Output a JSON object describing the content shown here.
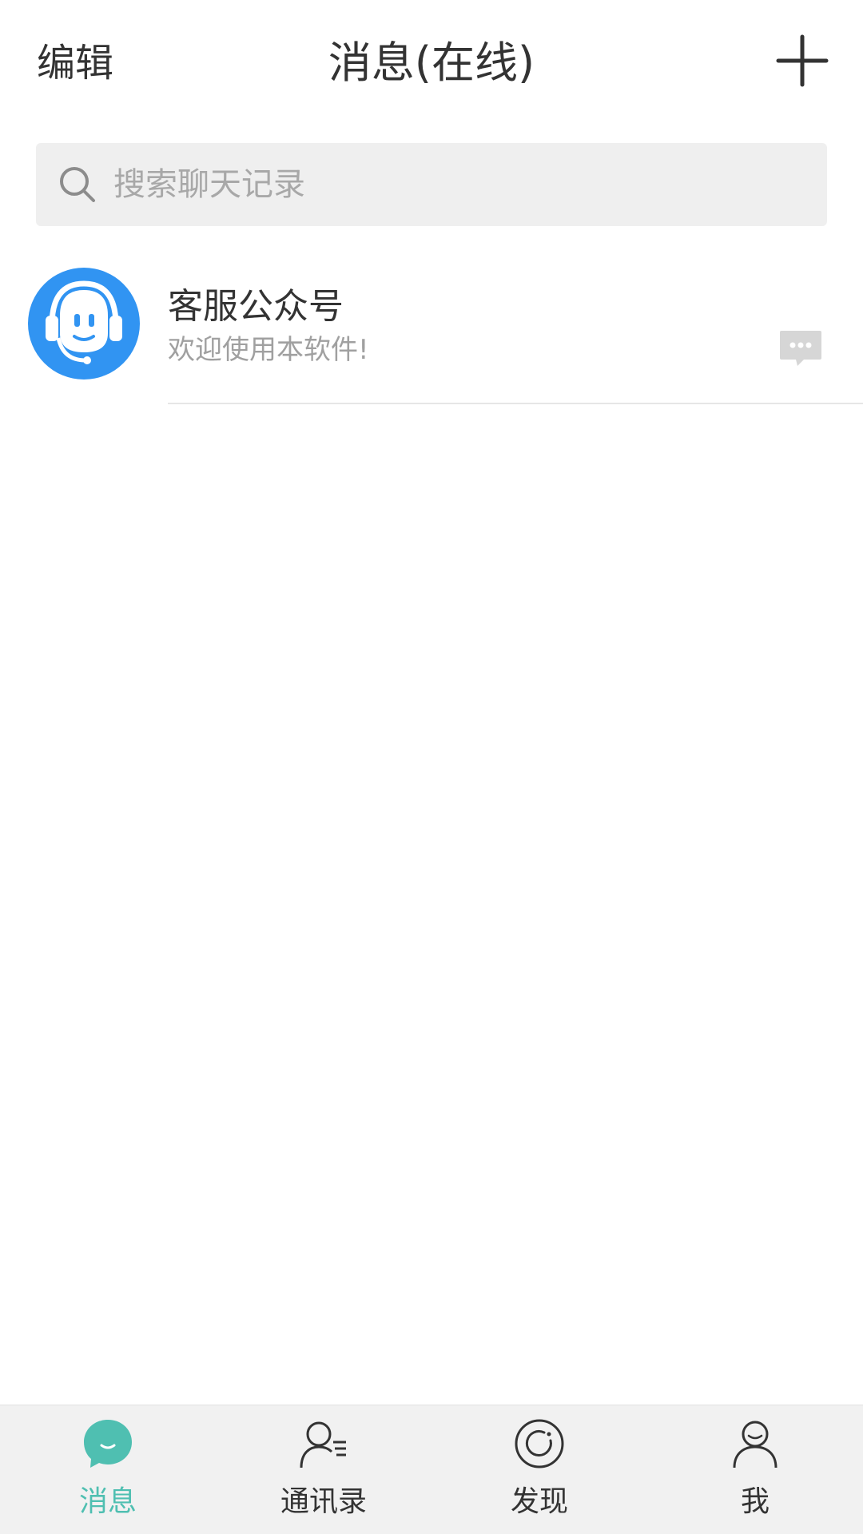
{
  "header": {
    "edit_label": "编辑",
    "title": "消息(在线)",
    "add_icon": "plus-icon"
  },
  "search": {
    "placeholder": "搜索聊天记录",
    "icon": "search-icon"
  },
  "conversations": [
    {
      "name": "客服公众号",
      "preview": "欢迎使用本软件!",
      "avatar_icon": "customer-service-headset-icon",
      "avatar_color": "#3194f2",
      "badge_icon": "chat-bubble-ellipsis-icon"
    }
  ],
  "tabbar": {
    "active_color": "#4fbfb1",
    "tabs": [
      {
        "label": "消息",
        "icon": "message-bubble-icon",
        "active": true
      },
      {
        "label": "通讯录",
        "icon": "contacts-icon",
        "active": false
      },
      {
        "label": "发现",
        "icon": "discover-icon",
        "active": false
      },
      {
        "label": "我",
        "icon": "profile-icon",
        "active": false
      }
    ]
  }
}
